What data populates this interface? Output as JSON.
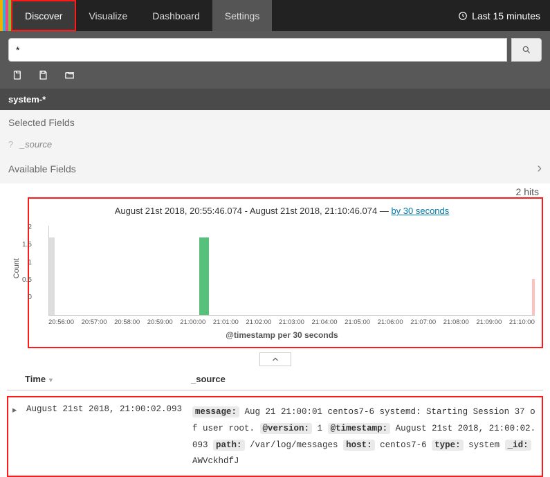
{
  "nav": {
    "tabs": [
      "Discover",
      "Visualize",
      "Dashboard",
      "Settings"
    ],
    "active": 0,
    "time_label": "Last 15 minutes"
  },
  "search": {
    "value": "*",
    "placeholder": ""
  },
  "toolbar_icons": [
    "new-search-icon",
    "save-icon",
    "open-icon"
  ],
  "index_pattern": "system-*",
  "fields": {
    "selected_heading": "Selected Fields",
    "selected": [
      "_source"
    ],
    "available_heading": "Available Fields"
  },
  "hits": {
    "count": 2,
    "label": "hits"
  },
  "chart_data": {
    "type": "bar",
    "title_range": "August 21st 2018, 20:55:46.074 - August 21st 2018, 21:10:46.074",
    "title_sep": " — ",
    "interval_link": "by 30 seconds",
    "xlabel": "@timestamp per 30 seconds",
    "ylabel": "Count",
    "ylim": [
      0,
      2
    ],
    "yticks": [
      "2",
      "1.5",
      "1",
      "0.5",
      "0"
    ],
    "xticks": [
      "20:56:00",
      "20:57:00",
      "20:58:00",
      "20:59:00",
      "21:00:00",
      "21:01:00",
      "21:02:00",
      "21:03:00",
      "21:04:00",
      "21:05:00",
      "21:06:00",
      "21:07:00",
      "21:08:00",
      "21:09:00",
      "21:10:00"
    ],
    "series": [
      {
        "name": "count",
        "x": "21:00:00",
        "value": 2
      }
    ]
  },
  "table": {
    "columns": {
      "time": "Time",
      "source": "_source"
    },
    "rows": [
      {
        "time": "August 21st 2018, 21:00:02.093",
        "source": {
          "message_k": "message:",
          "message_v": " Aug 21 21:00:01 centos7-6 systemd: Starting Session 37 of user root. ",
          "version_k": "@version:",
          "version_v": " 1 ",
          "timestamp_k": "@timestamp:",
          "timestamp_v": " August 21st 2018, 21:00:02.093 ",
          "path_k": "path:",
          "path_v": " /var/log/messages ",
          "host_k": "host:",
          "host_v": " centos7-6 ",
          "type_k": "type:",
          "type_v": " system ",
          "id_k": "_id:",
          "id_v": " AWVckhdfJ"
        }
      }
    ]
  }
}
